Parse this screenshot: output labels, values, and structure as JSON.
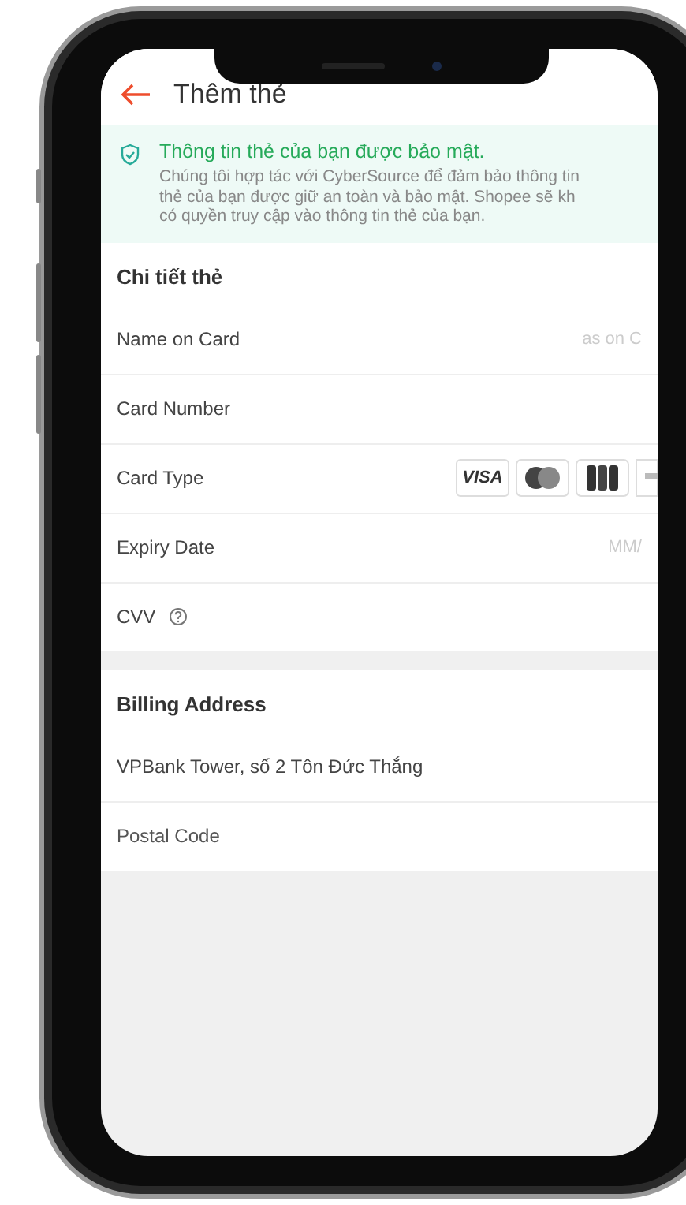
{
  "header": {
    "title": "Thêm thẻ"
  },
  "security_notice": {
    "title": "Thông tin thẻ của bạn được bảo mật.",
    "lines": [
      "Chúng tôi hợp tác với CyberSource để đảm bảo thông tin",
      "thẻ của bạn được giữ an toàn và bảo mật. Shopee sẽ kh",
      "có quyền truy cập vào thông tin thẻ của bạn."
    ]
  },
  "card_details": {
    "heading": "Chi tiết thẻ",
    "fields": [
      {
        "kind": "input",
        "label": "Name on Card",
        "placeholder": "as on C"
      },
      {
        "kind": "input",
        "label": "Card Number"
      },
      {
        "kind": "card_types",
        "label": "Card Type",
        "logos": [
          {
            "kind": "visa",
            "text": "VISA"
          },
          {
            "kind": "mastercard"
          },
          {
            "kind": "jcb"
          },
          {
            "kind": "other"
          }
        ]
      },
      {
        "kind": "input",
        "label": "Expiry Date",
        "placeholder": "MM/"
      },
      {
        "kind": "help",
        "label": "CVV"
      }
    ]
  },
  "billing_address": {
    "heading": "Billing Address",
    "fields": [
      {
        "kind": "value",
        "value": "VPBank Tower, số 2 Tôn Đức Thắng"
      },
      {
        "kind": "placeholder",
        "placeholder": "Postal Code"
      }
    ]
  }
}
